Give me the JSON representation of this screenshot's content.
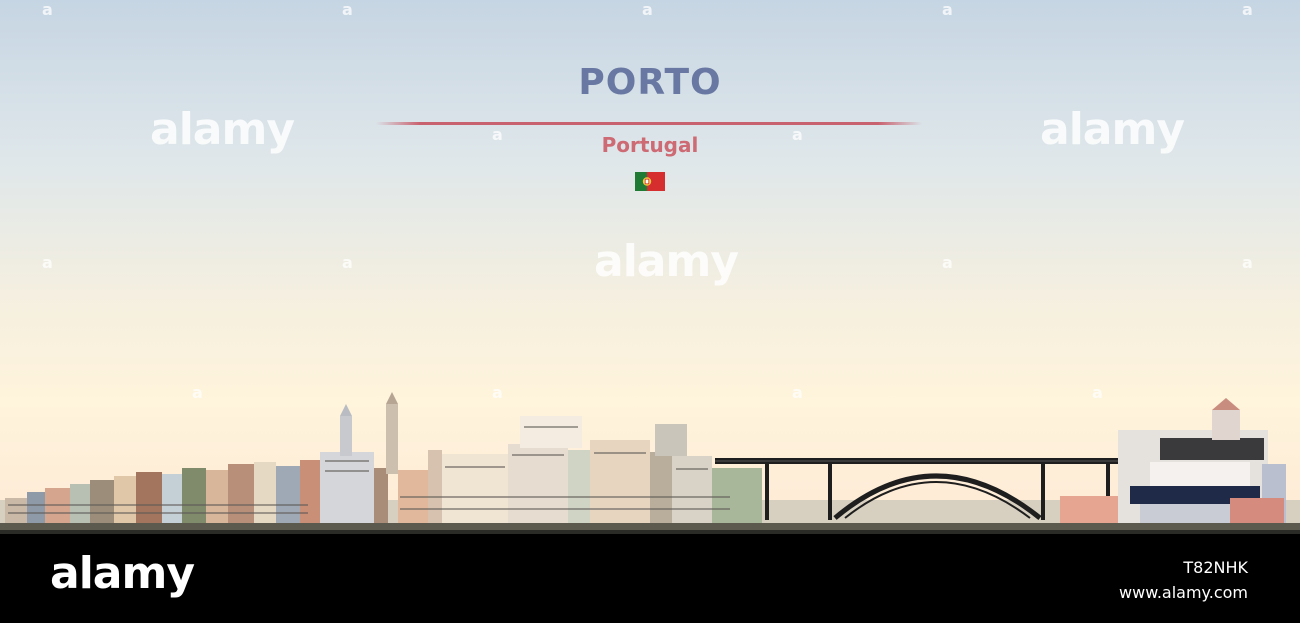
{
  "illustration": {
    "city": "PORTO",
    "country": "Portugal",
    "flag_icon": "portugal-flag-icon",
    "colors": {
      "title": "#6878a2",
      "subtitle": "#cd6a73",
      "sky_top": "#c6d5e3",
      "sky_bottom": "#fde9d5",
      "bridge": "#1e1e1e"
    }
  },
  "watermark": {
    "text": "alamy",
    "small_mark": "a"
  },
  "footer": {
    "logo": "alamy",
    "image_id": "T82NHK",
    "url": "www.alamy.com"
  }
}
